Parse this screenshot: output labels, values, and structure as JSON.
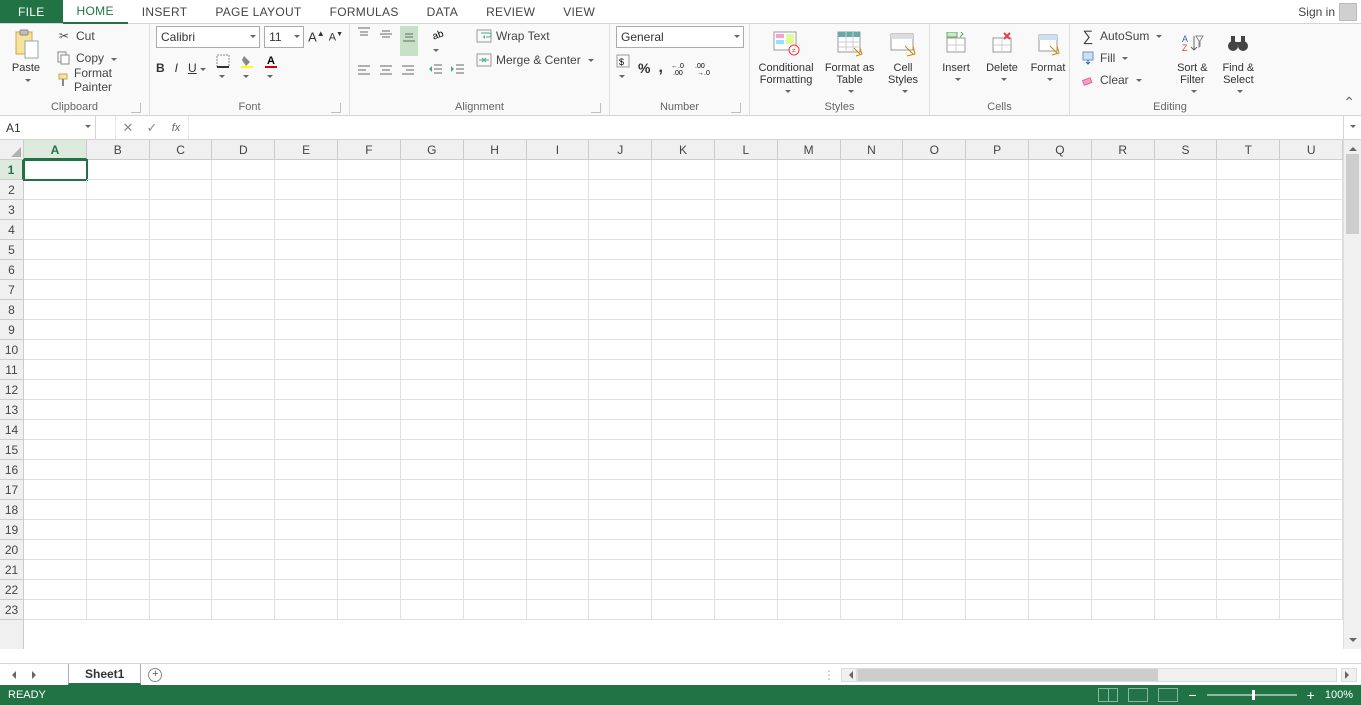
{
  "tabs": {
    "file": "FILE",
    "home": "HOME",
    "insert": "INSERT",
    "page_layout": "PAGE LAYOUT",
    "formulas": "FORMULAS",
    "data": "DATA",
    "review": "REVIEW",
    "view": "VIEW"
  },
  "signin": "Sign in",
  "clipboard": {
    "paste": "Paste",
    "cut": "Cut",
    "copy": "Copy",
    "painter": "Format Painter",
    "title": "Clipboard"
  },
  "font": {
    "name": "Calibri",
    "size": "11",
    "bold": "B",
    "italic": "I",
    "underline": "U",
    "title": "Font"
  },
  "alignment": {
    "wrap": "Wrap Text",
    "merge": "Merge & Center",
    "title": "Alignment"
  },
  "number": {
    "format": "General",
    "title": "Number"
  },
  "styles": {
    "cond": "Conditional\nFormatting",
    "table": "Format as\nTable",
    "cell": "Cell\nStyles",
    "title": "Styles"
  },
  "cells": {
    "insert": "Insert",
    "delete": "Delete",
    "format": "Format",
    "title": "Cells"
  },
  "editing": {
    "autosum": "AutoSum",
    "fill": "Fill",
    "clear": "Clear",
    "sort": "Sort &\nFilter",
    "find": "Find &\nSelect",
    "title": "Editing"
  },
  "namebox": "A1",
  "formula": "",
  "columns": [
    "A",
    "B",
    "C",
    "D",
    "E",
    "F",
    "G",
    "H",
    "I",
    "J",
    "K",
    "L",
    "M",
    "N",
    "O",
    "P",
    "Q",
    "R",
    "S",
    "T",
    "U"
  ],
  "rows": [
    "1",
    "2",
    "3",
    "4",
    "5",
    "6",
    "7",
    "8",
    "9",
    "10",
    "11",
    "12",
    "13",
    "14",
    "15",
    "16",
    "17",
    "18",
    "19",
    "20",
    "21",
    "22",
    "23"
  ],
  "active_cell": {
    "col": 0,
    "row": 0
  },
  "sheet": "Sheet1",
  "status": "READY",
  "zoom": "100%"
}
